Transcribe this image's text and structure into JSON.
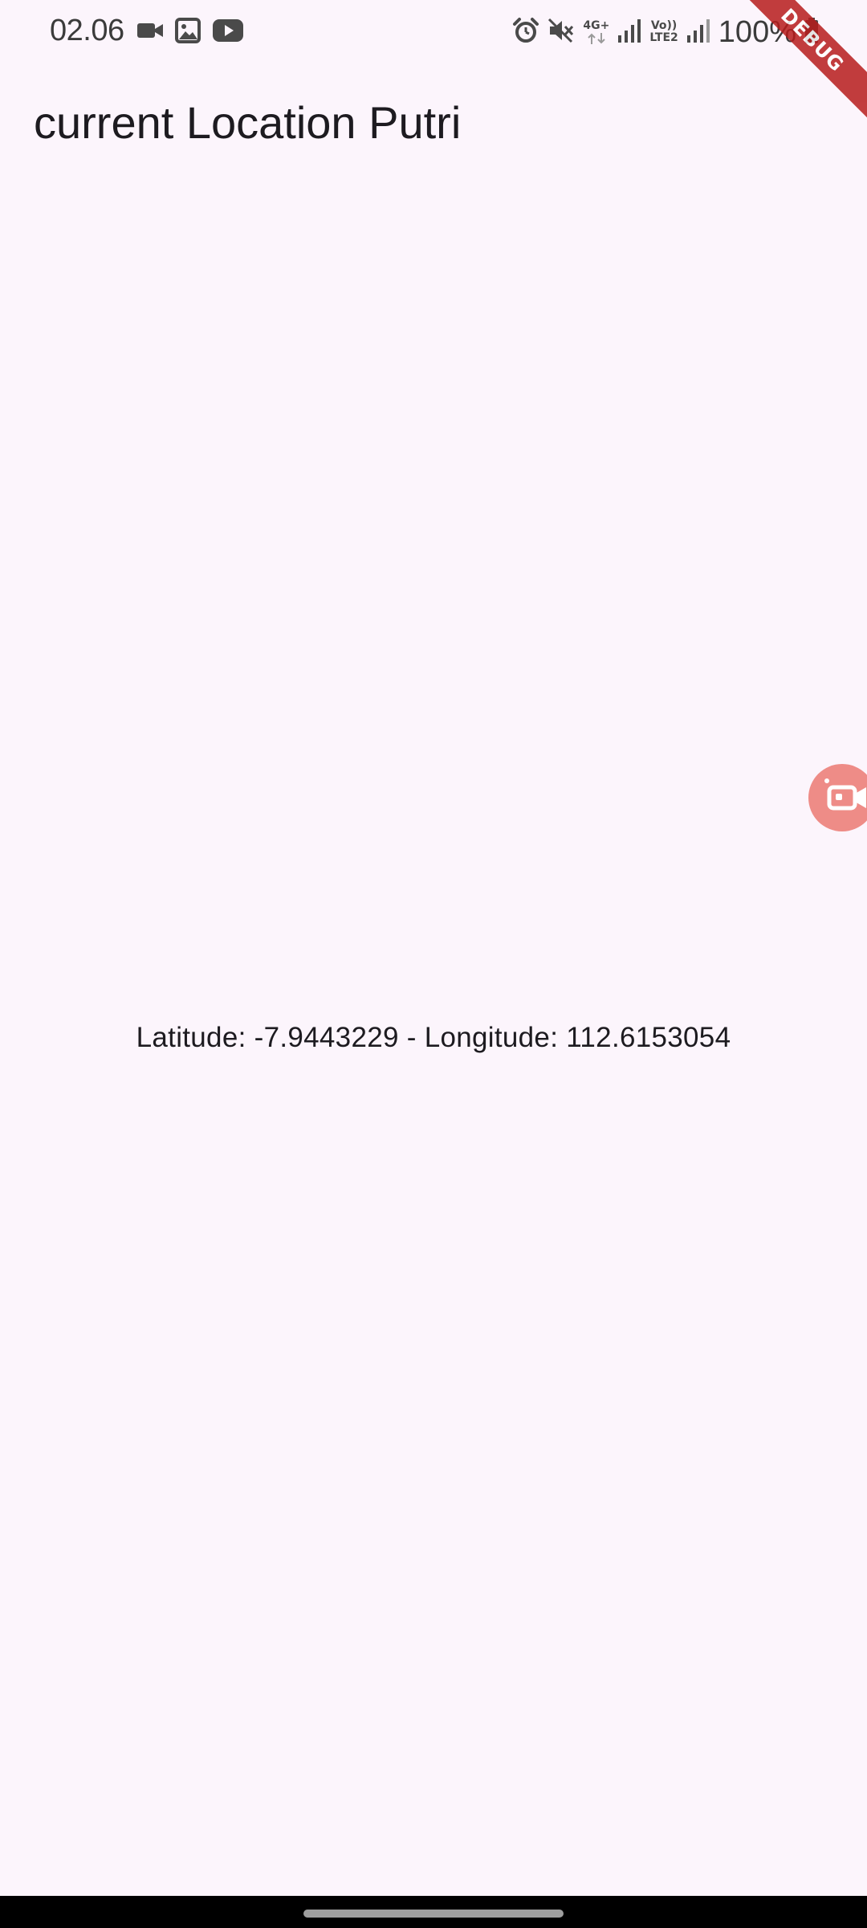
{
  "status_bar": {
    "time": "02.06",
    "battery_percent": "100%",
    "network_type": "4G+",
    "volte_label_top": "Vo))",
    "volte_label_bottom": "LTE2",
    "left_icons": [
      "video-camera-icon",
      "gallery-icon",
      "youtube-icon"
    ],
    "right_icons": [
      "alarm-icon",
      "mute-icon",
      "data-arrows-icon",
      "signal-icon",
      "volte-icon",
      "signal-icon",
      "battery-icon"
    ]
  },
  "app_bar": {
    "title": "current Location Putri"
  },
  "debug_banner": {
    "label": "DEBUG"
  },
  "location": {
    "text": "Latitude: -7.9443229 - Longitude: 112.6153054"
  },
  "floating_button": {
    "icon": "screen-recorder-icon"
  },
  "colors": {
    "background": "#FCF5FC",
    "text": "#1D1B20",
    "debug_banner": "#B71C1C",
    "floating_button": "#EE8C87",
    "nav_bar": "#000000"
  }
}
